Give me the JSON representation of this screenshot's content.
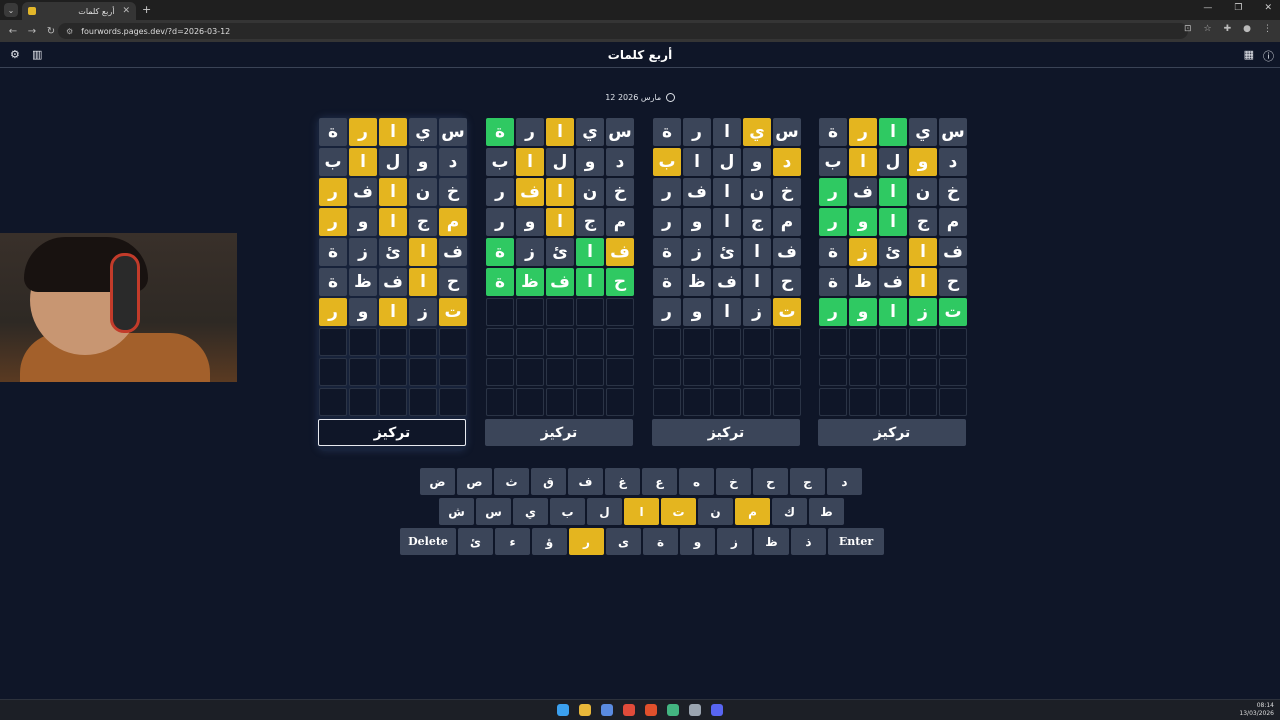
{
  "browser": {
    "tab_title": "أربع كلمات",
    "url": "fourwords.pages.dev/?d=2026-03-12"
  },
  "app": {
    "title": "أربع كلمات",
    "date": "12 مارس 2026",
    "focus_label": "تركيز"
  },
  "boards": [
    {
      "rows": [
        [
          [
            "س",
            "g"
          ],
          [
            "ي",
            "g"
          ],
          [
            "ا",
            "gr"
          ],
          [
            "ر",
            "y"
          ],
          [
            "ة",
            "g"
          ]
        ],
        [
          [
            "د",
            "g"
          ],
          [
            "و",
            "y"
          ],
          [
            "ل",
            "g"
          ],
          [
            "ا",
            "y"
          ],
          [
            "ب",
            "g"
          ]
        ],
        [
          [
            "خ",
            "g"
          ],
          [
            "ن",
            "g"
          ],
          [
            "ا",
            "gr"
          ],
          [
            "ف",
            "g"
          ],
          [
            "ر",
            "gr"
          ]
        ],
        [
          [
            "م",
            "g"
          ],
          [
            "ج",
            "g"
          ],
          [
            "ا",
            "gr"
          ],
          [
            "و",
            "gr"
          ],
          [
            "ر",
            "gr"
          ]
        ],
        [
          [
            "ف",
            "g"
          ],
          [
            "ا",
            "y"
          ],
          [
            "ئ",
            "g"
          ],
          [
            "ز",
            "y"
          ],
          [
            "ة",
            "g"
          ]
        ],
        [
          [
            "ح",
            "g"
          ],
          [
            "ا",
            "y"
          ],
          [
            "ف",
            "g"
          ],
          [
            "ظ",
            "g"
          ],
          [
            "ة",
            "g"
          ]
        ],
        [
          [
            "ت",
            "gr"
          ],
          [
            "ز",
            "gr"
          ],
          [
            "ا",
            "gr"
          ],
          [
            "و",
            "gr"
          ],
          [
            "ر",
            "gr"
          ]
        ]
      ]
    },
    {
      "rows": [
        [
          [
            "س",
            "g"
          ],
          [
            "ي",
            "y"
          ],
          [
            "ا",
            "g"
          ],
          [
            "ر",
            "g"
          ],
          [
            "ة",
            "g"
          ]
        ],
        [
          [
            "د",
            "y"
          ],
          [
            "و",
            "g"
          ],
          [
            "ل",
            "g"
          ],
          [
            "ا",
            "g"
          ],
          [
            "ب",
            "y"
          ]
        ],
        [
          [
            "خ",
            "g"
          ],
          [
            "ن",
            "g"
          ],
          [
            "ا",
            "g"
          ],
          [
            "ف",
            "g"
          ],
          [
            "ر",
            "g"
          ]
        ],
        [
          [
            "م",
            "g"
          ],
          [
            "ج",
            "g"
          ],
          [
            "ا",
            "g"
          ],
          [
            "و",
            "g"
          ],
          [
            "ر",
            "g"
          ]
        ],
        [
          [
            "ف",
            "g"
          ],
          [
            "ا",
            "g"
          ],
          [
            "ئ",
            "g"
          ],
          [
            "ز",
            "g"
          ],
          [
            "ة",
            "g"
          ]
        ],
        [
          [
            "ح",
            "g"
          ],
          [
            "ا",
            "g"
          ],
          [
            "ف",
            "g"
          ],
          [
            "ظ",
            "g"
          ],
          [
            "ة",
            "g"
          ]
        ],
        [
          [
            "ت",
            "y"
          ],
          [
            "ز",
            "g"
          ],
          [
            "ا",
            "g"
          ],
          [
            "و",
            "g"
          ],
          [
            "ر",
            "g"
          ]
        ]
      ]
    },
    {
      "rows": [
        [
          [
            "س",
            "g"
          ],
          [
            "ي",
            "g"
          ],
          [
            "ا",
            "y"
          ],
          [
            "ر",
            "g"
          ],
          [
            "ة",
            "gr"
          ]
        ],
        [
          [
            "د",
            "g"
          ],
          [
            "و",
            "g"
          ],
          [
            "ل",
            "g"
          ],
          [
            "ا",
            "y"
          ],
          [
            "ب",
            "g"
          ]
        ],
        [
          [
            "خ",
            "g"
          ],
          [
            "ن",
            "g"
          ],
          [
            "ا",
            "y"
          ],
          [
            "ف",
            "y"
          ],
          [
            "ر",
            "g"
          ]
        ],
        [
          [
            "م",
            "g"
          ],
          [
            "ج",
            "g"
          ],
          [
            "ا",
            "y"
          ],
          [
            "و",
            "g"
          ],
          [
            "ر",
            "g"
          ]
        ],
        [
          [
            "ف",
            "y"
          ],
          [
            "ا",
            "gr"
          ],
          [
            "ئ",
            "g"
          ],
          [
            "ز",
            "g"
          ],
          [
            "ة",
            "gr"
          ]
        ],
        [
          [
            "ح",
            "gr"
          ],
          [
            "ا",
            "gr"
          ],
          [
            "ف",
            "gr"
          ],
          [
            "ظ",
            "gr"
          ],
          [
            "ة",
            "gr"
          ]
        ]
      ]
    },
    {
      "rows": [
        [
          [
            "س",
            "g"
          ],
          [
            "ي",
            "g"
          ],
          [
            "ا",
            "y"
          ],
          [
            "ر",
            "y"
          ],
          [
            "ة",
            "g"
          ]
        ],
        [
          [
            "د",
            "g"
          ],
          [
            "و",
            "g"
          ],
          [
            "ل",
            "g"
          ],
          [
            "ا",
            "y"
          ],
          [
            "ب",
            "g"
          ]
        ],
        [
          [
            "خ",
            "g"
          ],
          [
            "ن",
            "g"
          ],
          [
            "ا",
            "y"
          ],
          [
            "ف",
            "g"
          ],
          [
            "ر",
            "y"
          ]
        ],
        [
          [
            "م",
            "y"
          ],
          [
            "ج",
            "g"
          ],
          [
            "ا",
            "y"
          ],
          [
            "و",
            "g"
          ],
          [
            "ر",
            "y"
          ]
        ],
        [
          [
            "ف",
            "g"
          ],
          [
            "ا",
            "y"
          ],
          [
            "ئ",
            "g"
          ],
          [
            "ز",
            "g"
          ],
          [
            "ة",
            "g"
          ]
        ],
        [
          [
            "ح",
            "g"
          ],
          [
            "ا",
            "y"
          ],
          [
            "ف",
            "g"
          ],
          [
            "ظ",
            "g"
          ],
          [
            "ة",
            "g"
          ]
        ],
        [
          [
            "ت",
            "y"
          ],
          [
            "ز",
            "g"
          ],
          [
            "ا",
            "y"
          ],
          [
            "و",
            "g"
          ],
          [
            "ر",
            "y"
          ]
        ]
      ]
    }
  ],
  "keyboard": {
    "row1": [
      [
        "د",
        "g"
      ],
      [
        "ج",
        "g"
      ],
      [
        "ح",
        "g"
      ],
      [
        "خ",
        "g"
      ],
      [
        "ه",
        "g"
      ],
      [
        "ع",
        "g"
      ],
      [
        "غ",
        "g"
      ],
      [
        "ف",
        "g"
      ],
      [
        "ق",
        "g"
      ],
      [
        "ث",
        "g"
      ],
      [
        "ص",
        "g"
      ],
      [
        "ض",
        "g"
      ]
    ],
    "row2": [
      [
        "ط",
        "g"
      ],
      [
        "ك",
        "g"
      ],
      [
        "م",
        "y"
      ],
      [
        "ن",
        "g"
      ],
      [
        "ت",
        "y"
      ],
      [
        "ا",
        "y"
      ],
      [
        "ل",
        "g"
      ],
      [
        "ب",
        "g"
      ],
      [
        "ي",
        "g"
      ],
      [
        "س",
        "g"
      ],
      [
        "ش",
        "g"
      ]
    ],
    "row3": [
      [
        "Enter",
        "w"
      ],
      [
        "ذ",
        "g"
      ],
      [
        "ظ",
        "g"
      ],
      [
        "ز",
        "g"
      ],
      [
        "و",
        "g"
      ],
      [
        "ة",
        "g"
      ],
      [
        "ى",
        "g"
      ],
      [
        "ر",
        "y"
      ],
      [
        "ؤ",
        "g"
      ],
      [
        "ء",
        "g"
      ],
      [
        "ئ",
        "g"
      ],
      [
        "Delete",
        "w"
      ]
    ]
  },
  "taskbar": {
    "time": "08:14",
    "date": "13/03/2026"
  }
}
